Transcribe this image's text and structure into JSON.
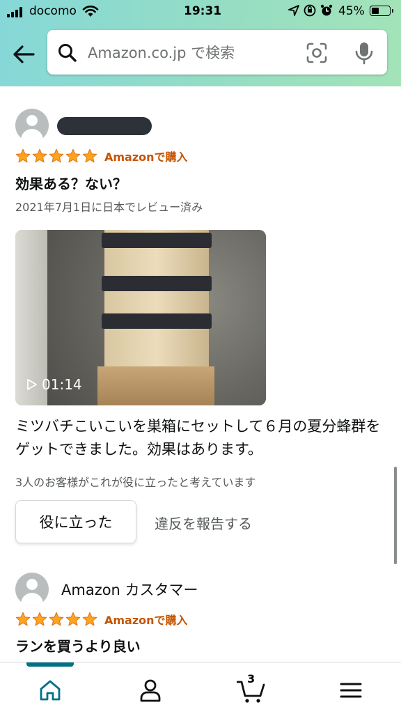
{
  "status_bar": {
    "carrier": "docomo",
    "time": "19:31",
    "battery": "45%",
    "battery_level": 0.45
  },
  "search": {
    "placeholder": "Amazon.co.jp で検索"
  },
  "reviews": [
    {
      "reviewer": "",
      "rating": 5,
      "verified_label": "Amazonで購入",
      "title": "効果ある？ない？",
      "date": "2021年7月1日に日本でレビュー済み",
      "video_duration": "01:14",
      "body": "ミツバチこいこいを巣箱にセットして６月の夏分蜂群をゲットできました。効果はあります。",
      "helpful_count": "3人のお客様がこれが役に立ったと考えています",
      "helpful_button": "役に立った",
      "report_link": "違反を報告する"
    },
    {
      "reviewer": "Amazon カスタマー",
      "rating": 5,
      "verified_label": "Amazonで購入",
      "title": "ランを買うより良い"
    }
  ],
  "bottom_nav": {
    "cart_count": "3",
    "items": [
      "home-icon",
      "account-icon",
      "cart-icon",
      "menu-icon"
    ]
  },
  "colors": {
    "header_gradient_start": "#86d8d8",
    "header_gradient_end": "#a3e3b8",
    "star": "#ffa41c",
    "verified": "#c45500",
    "nav_active": "#007185"
  }
}
